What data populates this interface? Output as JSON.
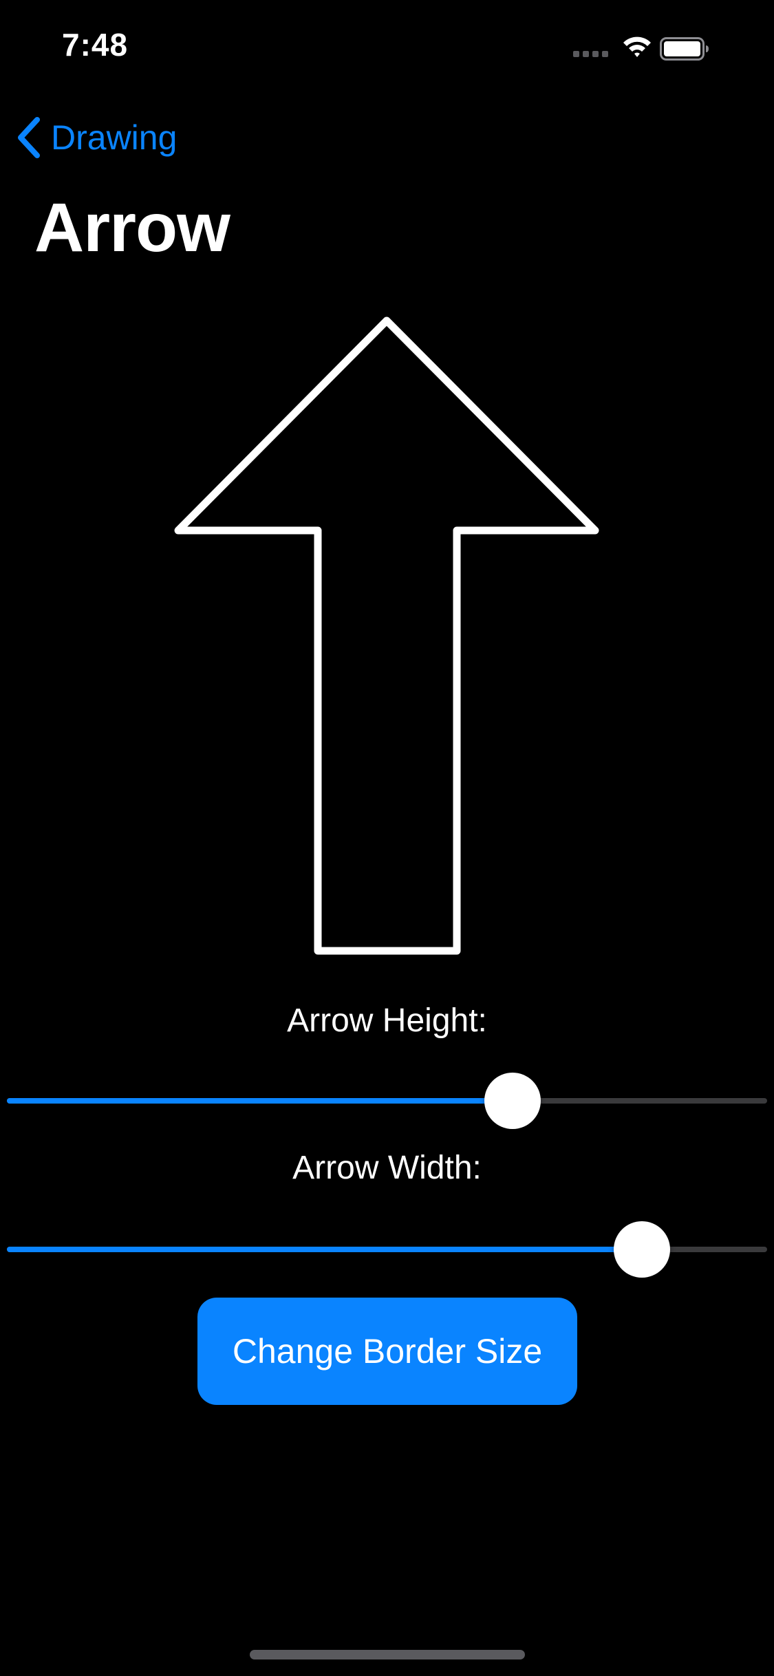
{
  "status_bar": {
    "time": "7:48",
    "icons": [
      "signal-icon",
      "wifi-icon",
      "battery-icon"
    ]
  },
  "nav": {
    "back_label": "Drawing",
    "back_icon": "chevron-left-icon",
    "title": "Arrow"
  },
  "controls": {
    "arrow_height": {
      "label": "Arrow Height:",
      "value": 0.665
    },
    "arrow_width": {
      "label": "Arrow Width:",
      "value": 0.835
    }
  },
  "action_button": {
    "label": "Change Border Size"
  },
  "colors": {
    "background": "#000000",
    "accent": "#0A84FF",
    "foreground": "#FFFFFF",
    "track": "#3A3A3C"
  }
}
